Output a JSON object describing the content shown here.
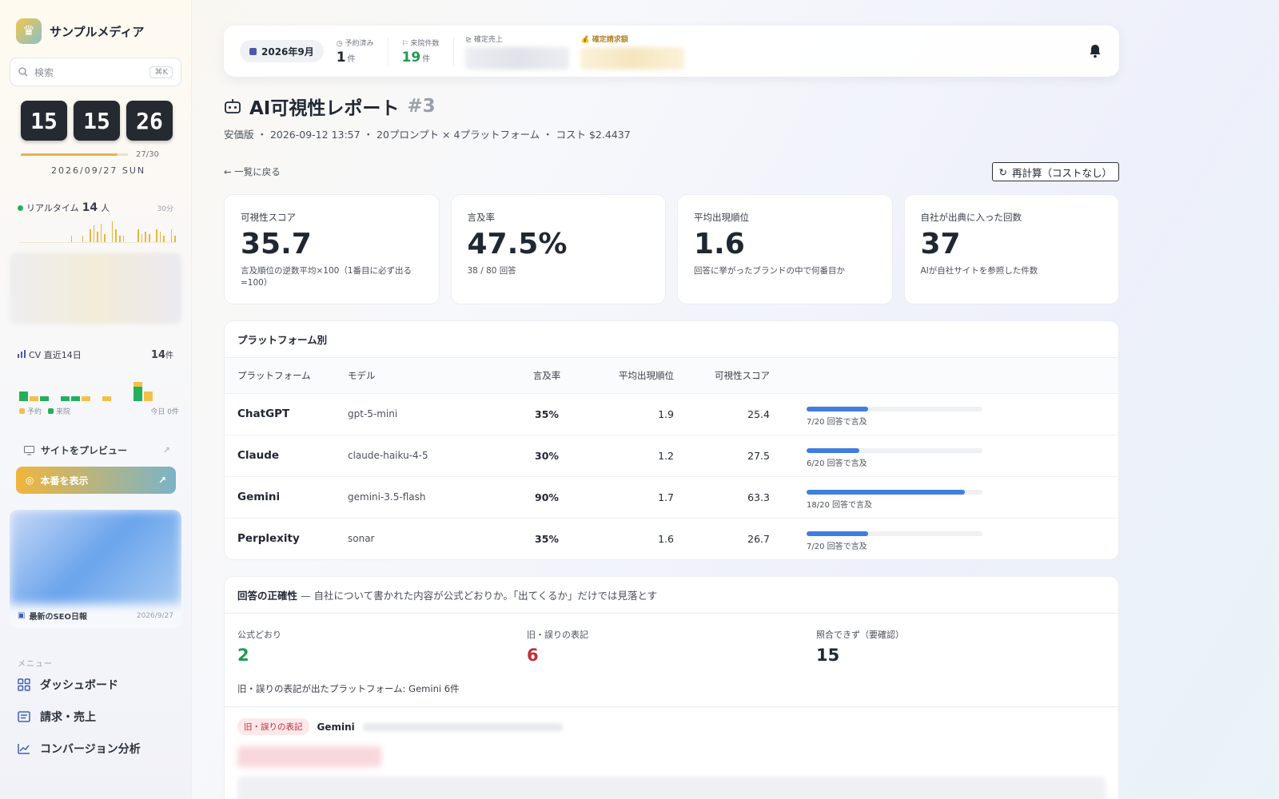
{
  "sidebar": {
    "brand": "サンプルメディア",
    "search_placeholder": "検索",
    "search_shortcut": "⌘K",
    "clock": [
      "15",
      "15",
      "26"
    ],
    "progress": {
      "text": "27/30",
      "fraction": 0.9
    },
    "date": "2026/09/27 SUN",
    "realtime": {
      "label": "リアルタイム",
      "count": "14",
      "unit": "人",
      "span": "30分",
      "bars": [
        0,
        0,
        0,
        0,
        0,
        0,
        0,
        0,
        0,
        0,
        0,
        0,
        0,
        0,
        3,
        0,
        0,
        3,
        0,
        6,
        8,
        5,
        9,
        4,
        0,
        10,
        6,
        3,
        3,
        0,
        0,
        0,
        6,
        4,
        5,
        4,
        0,
        6,
        5,
        3,
        0,
        6,
        3
      ]
    },
    "cv": {
      "label": "CV 直近14日",
      "count": "14",
      "unit": "件",
      "bars": [
        [
          0,
          20
        ],
        [
          10,
          0
        ],
        [
          0,
          10
        ],
        [
          0,
          0
        ],
        [
          0,
          10
        ],
        [
          0,
          10
        ],
        [
          10,
          0
        ],
        [
          0,
          0
        ],
        [
          10,
          0
        ],
        [
          0,
          0
        ],
        [
          0,
          0
        ],
        [
          10,
          30
        ],
        [
          20,
          0
        ],
        [
          0,
          0
        ]
      ],
      "legend_a": "予約",
      "legend_b": "来院",
      "today": "今日 0件"
    },
    "preview_label": "サイトをプレビュー",
    "live_label": "本番を表示",
    "seo": {
      "label": "最新のSEO日報",
      "date": "2026/9/27"
    },
    "menu_label": "メニュー",
    "menu": [
      {
        "label": "ダッシュボード",
        "icon": "grid-icon"
      },
      {
        "label": "請求・売上",
        "icon": "invoice-icon"
      },
      {
        "label": "コンバージョン分析",
        "icon": "chart-line-icon"
      }
    ]
  },
  "topbar": {
    "month": "2026年9月",
    "reserved": {
      "label": "予約済み",
      "value": "1",
      "unit": "件"
    },
    "visits": {
      "label": "来院件数",
      "value": "19",
      "unit": "件"
    },
    "sales_label": "確定売上",
    "billing_label": "確定請求額"
  },
  "report": {
    "title": "AI可視性レポート",
    "number": "#3",
    "meta": "安価版 ・ 2026-09-12 13:57 ・ 20プロンプト × 4プラットフォーム ・ コスト $2.4437",
    "back": "← 一覧に戻る",
    "recalc": "再計算（コストなし）"
  },
  "kpis": [
    {
      "label": "可視性スコア",
      "value": "35.7",
      "sub": "言及順位の逆数平均×100（1番目に必ず出る=100）"
    },
    {
      "label": "言及率",
      "value": "47.5%",
      "sub": "38 / 80 回答"
    },
    {
      "label": "平均出現順位",
      "value": "1.6",
      "sub": "回答に挙がったブランドの中で何番目か"
    },
    {
      "label": "自社が出典に入った回数",
      "value": "37",
      "sub": "AIが自社サイトを参照した件数"
    }
  ],
  "platforms": {
    "title": "プラットフォーム別",
    "headers": [
      "プラットフォーム",
      "モデル",
      "言及率",
      "平均出現順位",
      "可視性スコア"
    ],
    "rows": [
      {
        "name": "ChatGPT",
        "model": "gpt-5-mini",
        "rate": "35%",
        "rank": "1.9",
        "score": "25.4",
        "fraction": 0.35,
        "caption": "7/20 回答で言及"
      },
      {
        "name": "Claude",
        "model": "claude-haiku-4-5",
        "rate": "30%",
        "rank": "1.2",
        "score": "27.5",
        "fraction": 0.3,
        "caption": "6/20 回答で言及"
      },
      {
        "name": "Gemini",
        "model": "gemini-3.5-flash",
        "rate": "90%",
        "rank": "1.7",
        "score": "63.3",
        "fraction": 0.9,
        "caption": "18/20 回答で言及"
      },
      {
        "name": "Perplexity",
        "model": "sonar",
        "rate": "35%",
        "rank": "1.6",
        "score": "26.7",
        "fraction": 0.35,
        "caption": "7/20 回答で言及"
      }
    ]
  },
  "accuracy": {
    "title": "回答の正確性",
    "note": "— 自社について書かれた内容が公式どおりか。「出てくるか」だけでは見落とす",
    "items": [
      {
        "label": "公式どおり",
        "value": "2",
        "color": "#1f9a52"
      },
      {
        "label": "旧・誤りの表記",
        "value": "6",
        "color": "#c0303a"
      },
      {
        "label": "照合できず（要確認）",
        "value": "15",
        "color": "#1f2733"
      }
    ],
    "footer": "旧・誤りの表記が出たプラットフォーム: Gemini 6件",
    "tag": "旧・誤りの表記",
    "platform": "Gemini"
  },
  "colors": {
    "accent": "#3f7ee0",
    "gold": "#e9b63e",
    "green": "#22b05c"
  }
}
